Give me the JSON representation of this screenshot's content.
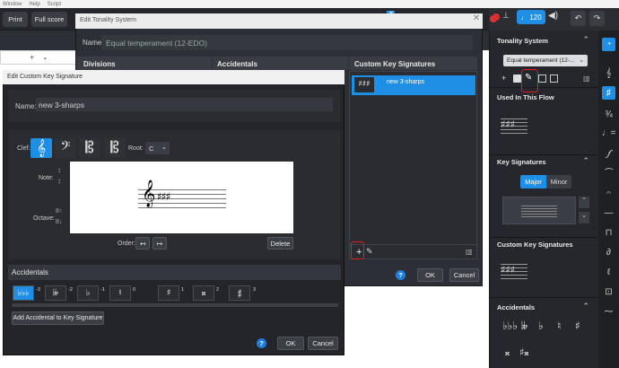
{
  "menubar": {
    "items": [
      "Window",
      "Help",
      "Script"
    ]
  },
  "toolbar": {
    "print_label": "Print",
    "full_score_label": "Full score",
    "tempo": "120"
  },
  "tonality_dialog": {
    "title": "Edit Tonality System",
    "name_label": "Name:",
    "name_value": "Equal temperament (12-EDO)",
    "divisions_label": "Divisions",
    "accidentals_label": "Accidentals",
    "custom_key_sigs_label": "Custom Key Signatures",
    "item_name": "new 3-sharps",
    "ok_label": "OK",
    "cancel_label": "Cancel",
    "help": "?"
  },
  "key_sig_dialog": {
    "title": "Edit Custom Key Signature",
    "name_label": "Name:",
    "name_value": "new 3-sharps",
    "clef_label": "Clef:",
    "root_label": "Root:",
    "root_value": "C",
    "note_label": "Note:",
    "octave_label": "Octave:",
    "order_label": "Order:",
    "delete_label": "Delete",
    "accidentals_section": "Accidentals",
    "add_accidental_label": "Add Accidental to Key Signature",
    "ok_label": "OK",
    "cancel_label": "Cancel",
    "help": "?",
    "accidentals": [
      {
        "sym": "𝄫",
        "num": "-3"
      },
      {
        "sym": "𝄫",
        "num": "-2"
      },
      {
        "sym": "♭",
        "num": "-1"
      },
      {
        "sym": "♮",
        "num": "0"
      },
      {
        "sym": "♯",
        "num": "1"
      },
      {
        "sym": "𝄪",
        "num": "2"
      },
      {
        "sym": "𝄰",
        "num": "3"
      }
    ]
  },
  "right_panel": {
    "tonality_header": "Tonality System",
    "tonality_select": "Equal temperament (12-...",
    "used_in_flow": "Used In This Flow",
    "key_signatures": "Key Signatures",
    "major_label": "Major",
    "minor_label": "Minor",
    "custom_key_sigs": "Custom Key Signatures",
    "accidentals": "Accidentals"
  },
  "colors": {
    "accent": "#1f8fe6",
    "highlight": "#e0201b"
  }
}
